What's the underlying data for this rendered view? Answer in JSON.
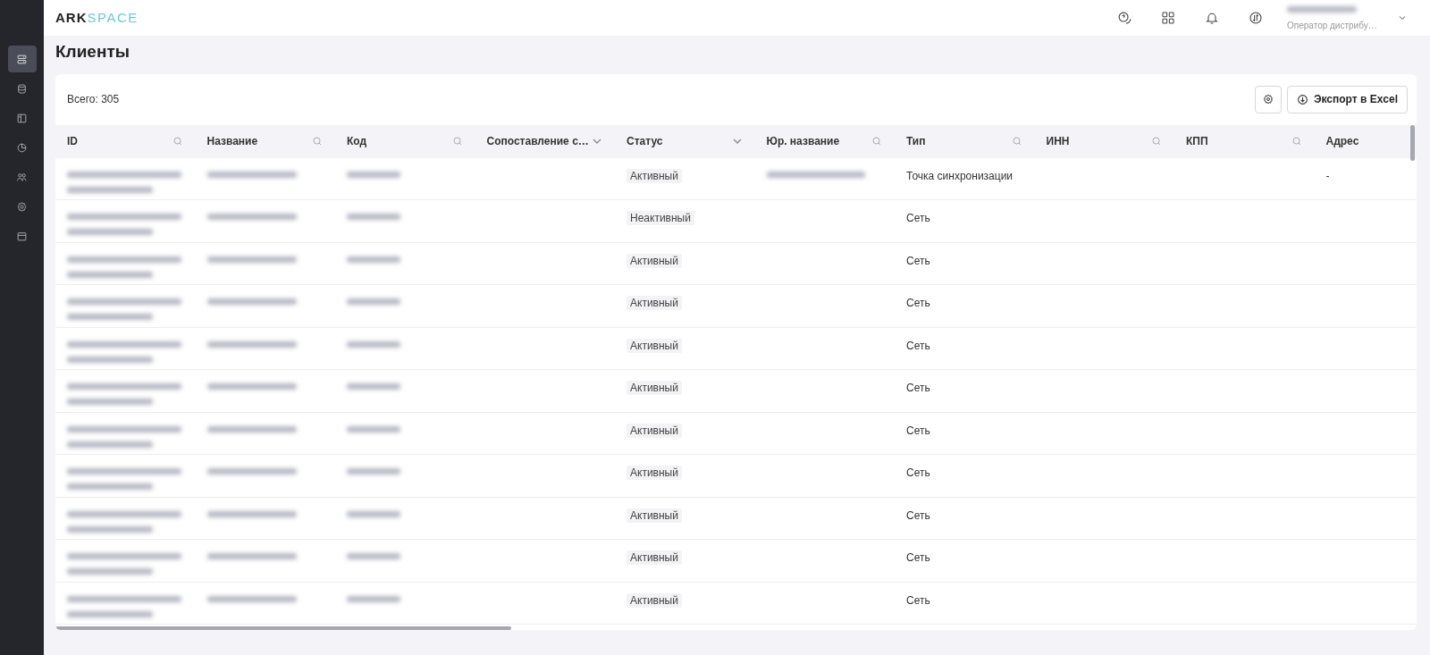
{
  "logo": {
    "part_1": "ARK",
    "part_2": "SPACE"
  },
  "sidebar": {
    "items": [
      {
        "selected": true
      },
      {
        "selected": false
      },
      {
        "selected": false
      },
      {
        "selected": false
      },
      {
        "selected": false
      },
      {
        "selected": false
      },
      {
        "selected": false
      }
    ]
  },
  "user": {
    "role": "Оператор дистрибу…"
  },
  "page_title": "Клиенты",
  "total": "Всего: 305",
  "export_button": "Экспорт в Excel",
  "table": {
    "columns": [
      {
        "label": "ID",
        "kind": "search"
      },
      {
        "label": "Название",
        "kind": "search"
      },
      {
        "label": "Код",
        "kind": "search"
      },
      {
        "label": "Сопоставление с…",
        "kind": "dropdown"
      },
      {
        "label": "Статус",
        "kind": "dropdown"
      },
      {
        "label": "Юр. название",
        "kind": "search"
      },
      {
        "label": "Тип",
        "kind": "search"
      },
      {
        "label": "ИНН",
        "kind": "search"
      },
      {
        "label": "КПП",
        "kind": "search"
      },
      {
        "label": "Адрес",
        "kind": "plain"
      }
    ],
    "rows": [
      {
        "status": "Активный",
        "legal_name_hidden": true,
        "type": "Точка синхронизации",
        "address": "-"
      },
      {
        "status": "Неактивный",
        "legal_name_hidden": false,
        "type": "Сеть"
      },
      {
        "status": "Активный",
        "legal_name_hidden": false,
        "type": "Сеть"
      },
      {
        "status": "Активный",
        "legal_name_hidden": false,
        "type": "Сеть"
      },
      {
        "status": "Активный",
        "legal_name_hidden": false,
        "type": "Сеть"
      },
      {
        "status": "Активный",
        "legal_name_hidden": false,
        "type": "Сеть"
      },
      {
        "status": "Активный",
        "legal_name_hidden": false,
        "type": "Сеть"
      },
      {
        "status": "Активный",
        "legal_name_hidden": false,
        "type": "Сеть"
      },
      {
        "status": "Активный",
        "legal_name_hidden": false,
        "type": "Сеть"
      },
      {
        "status": "Активный",
        "legal_name_hidden": false,
        "type": "Сеть"
      },
      {
        "status": "Активный",
        "legal_name_hidden": false,
        "type": "Сеть"
      }
    ]
  }
}
